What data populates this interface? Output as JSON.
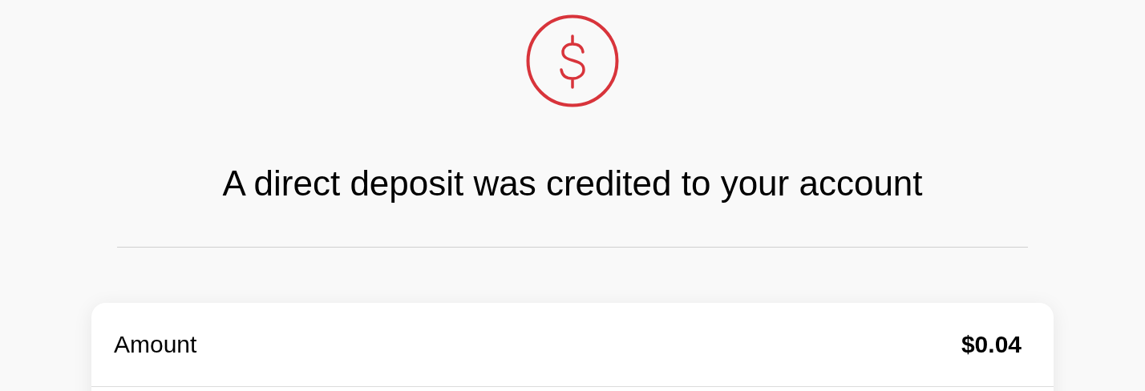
{
  "title": "A direct deposit was credited to your account",
  "details": [
    {
      "label": "Amount",
      "value": "$0.04"
    }
  ]
}
